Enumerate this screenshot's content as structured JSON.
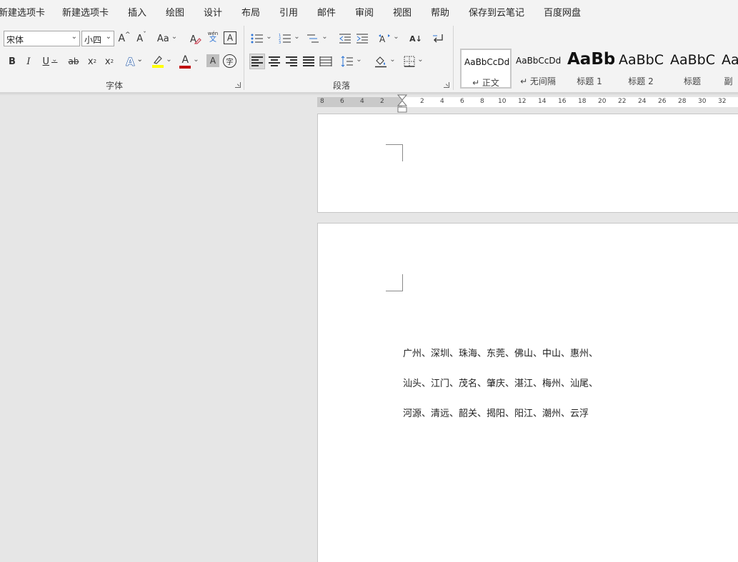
{
  "menu": {
    "tabs": [
      "新建选项卡",
      "新建选项卡",
      "插入",
      "绘图",
      "设计",
      "布局",
      "引用",
      "邮件",
      "审阅",
      "视图",
      "帮助",
      "保存到云笔记",
      "百度网盘"
    ]
  },
  "font_group": {
    "font_name": "宋体",
    "font_size": "小四",
    "grow_label": "A",
    "shrink_label": "A",
    "case_label": "Aa",
    "phonetic_top": "wén",
    "phonetic_bottom": "文",
    "char_border_label": "A",
    "bold": "B",
    "italic": "I",
    "underline": "U",
    "strike": "ab",
    "subscript": "x",
    "subscript_mark": "2",
    "superscript": "x",
    "superscript_mark": "2",
    "text_effect": "A",
    "font_color_label": "A",
    "char_shading_label": "A",
    "enclose_label": "字",
    "label": "字体"
  },
  "paragraph_group": {
    "sort_label": "A↓",
    "label": "段落"
  },
  "styles": [
    {
      "sample": "AaBbCcDd",
      "name": "↵ 正文"
    },
    {
      "sample": "AaBbCcDd",
      "name": "↵ 无间隔"
    },
    {
      "sample": "AaBb",
      "name": "标题 1"
    },
    {
      "sample": "AaBbC",
      "name": "标题 2"
    },
    {
      "sample": "AaBbC",
      "name": "标题"
    },
    {
      "sample": "Aa",
      "name": "副"
    }
  ],
  "ruler": {
    "left_numbers": [
      "8",
      "6",
      "4",
      "2"
    ],
    "right_numbers": [
      "2",
      "4",
      "6",
      "8",
      "10",
      "12",
      "14",
      "16",
      "18",
      "20",
      "22",
      "24",
      "26",
      "28",
      "30",
      "32"
    ]
  },
  "document": {
    "lines": [
      "广州、深圳、珠海、东莞、佛山、中山、惠州、",
      "汕头、江门、茂名、肇庆、湛江、梅州、汕尾、",
      "河源、清远、韶关、揭阳、阳江、潮州、云浮"
    ]
  },
  "colors": {
    "font_color_bar": "#c00000",
    "highlight_bar": "#ffff00",
    "text_effect": "#2e75d6"
  }
}
